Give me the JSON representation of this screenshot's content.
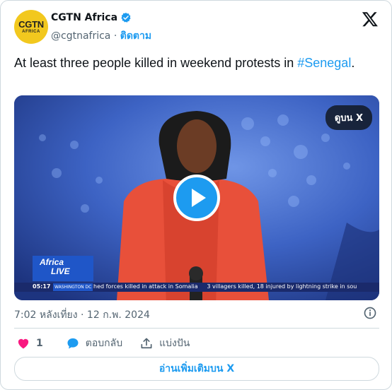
{
  "account": {
    "avatar_line1": "CGTN",
    "avatar_line2": "AFRICA",
    "name": "CGTN Africa",
    "handle": "@cgtnafrica",
    "separator": " · ",
    "follow_label": "ติดตาม"
  },
  "tweet": {
    "text_before": "At least three people killed in weekend protests in ",
    "hashtag": "#Senegal",
    "text_after": ".",
    "timestamp": "7:02 หลังเที่ยง · 12 ก.พ. 2024"
  },
  "media": {
    "watch_label": "ดูบน X",
    "badge_line1": "Africa",
    "badge_line2": "LIVE",
    "clock": "05:17",
    "location": "WASHINGTON DC",
    "ticker_text": "hed forces killed in attack in Somalia     3 villagers killed, 18 injured by lightning strike in sou"
  },
  "actions": {
    "like_count": "1",
    "reply_label": "ตอบกลับ",
    "share_label": "แบ่งปัน"
  },
  "read_more_label": "อ่านเพิ่มเติมบน X",
  "colors": {
    "accent": "#1d9bf0",
    "like": "#f91880",
    "text": "#0f1419",
    "muted": "#536471",
    "border": "#cfd9de"
  }
}
